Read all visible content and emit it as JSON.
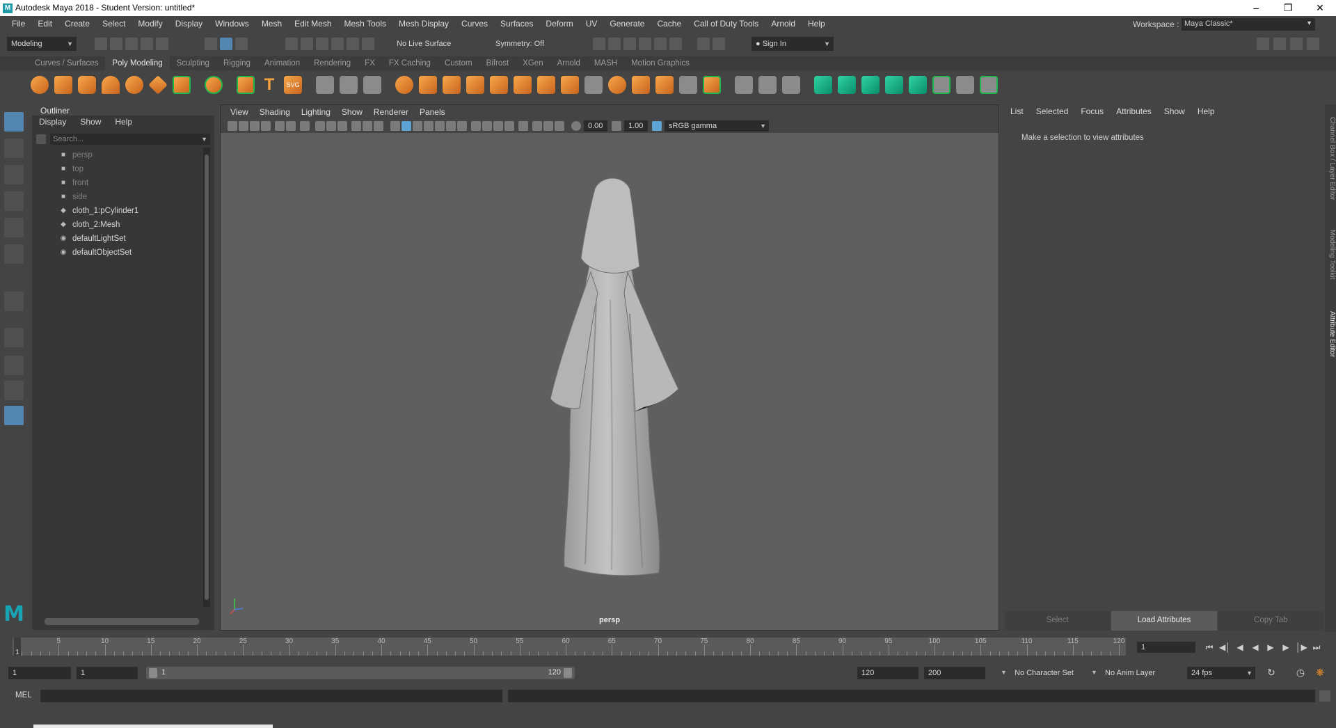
{
  "window": {
    "title": "Autodesk Maya 2018 - Student Version: untitled*",
    "app_icon": "M"
  },
  "menubar": [
    "File",
    "Edit",
    "Create",
    "Select",
    "Modify",
    "Display",
    "Windows",
    "Mesh",
    "Edit Mesh",
    "Mesh Tools",
    "Mesh Display",
    "Curves",
    "Surfaces",
    "Deform",
    "UV",
    "Generate",
    "Cache",
    "Call of Duty Tools",
    "Arnold",
    "Help"
  ],
  "workspace": {
    "label": "Workspace :",
    "value": "Maya Classic*"
  },
  "statusline": {
    "mode": "Modeling",
    "live_surface": "No Live Surface",
    "symmetry": "Symmetry: Off",
    "sign_in": "Sign In"
  },
  "shelf_tabs": {
    "items": [
      "Curves / Surfaces",
      "Poly Modeling",
      "Sculpting",
      "Rigging",
      "Animation",
      "Rendering",
      "FX",
      "FX Caching",
      "Custom",
      "Bifrost",
      "XGen",
      "Arnold",
      "MASH",
      "Motion Graphics"
    ],
    "active": "Poly Modeling"
  },
  "outliner": {
    "title": "Outliner",
    "menus": [
      "Display",
      "Show",
      "Help"
    ],
    "search_placeholder": "Search...",
    "items": [
      {
        "label": "persp",
        "icon": "camera-icon",
        "dim": true
      },
      {
        "label": "top",
        "icon": "camera-icon",
        "dim": true
      },
      {
        "label": "front",
        "icon": "camera-icon",
        "dim": true
      },
      {
        "label": "side",
        "icon": "camera-icon",
        "dim": true
      },
      {
        "label": "cloth_1:pCylinder1",
        "icon": "mesh-icon",
        "dim": false
      },
      {
        "label": "cloth_2:Mesh",
        "icon": "mesh-icon",
        "dim": false
      },
      {
        "label": "defaultLightSet",
        "icon": "set-icon",
        "dim": false
      },
      {
        "label": "defaultObjectSet",
        "icon": "set-icon",
        "dim": false
      }
    ]
  },
  "viewport": {
    "menus": [
      "View",
      "Shading",
      "Lighting",
      "Show",
      "Renderer",
      "Panels"
    ],
    "exposure": "0.00",
    "gamma": "1.00",
    "color_space": "sRGB gamma",
    "camera": "persp"
  },
  "attribute_editor": {
    "menus": [
      "List",
      "Selected",
      "Focus",
      "Attributes",
      "Show",
      "Help"
    ],
    "message": "Make a selection to view attributes",
    "buttons": [
      "Select",
      "Load Attributes",
      "Copy Tab"
    ]
  },
  "side_tabs": [
    "Channel Box / Layer Editor",
    "Modeling Toolkit",
    "Attribute Editor"
  ],
  "timeline": {
    "tick_labels": [
      "5",
      "10",
      "15",
      "20",
      "25",
      "30",
      "35",
      "40",
      "45",
      "50",
      "55",
      "60",
      "65",
      "70",
      "75",
      "80",
      "85",
      "90",
      "95",
      "100",
      "105",
      "110",
      "115",
      "120"
    ],
    "current_frame": "1",
    "marker_label": "1"
  },
  "range": {
    "start": "1",
    "playback_start": "1",
    "slider_start": "1",
    "slider_end": "120",
    "playback_end": "120",
    "end": "200",
    "character_set": "No Character Set",
    "anim_layer": "No Anim Layer",
    "fps": "24 fps"
  },
  "command_line": {
    "label": "MEL"
  },
  "colors": {
    "accent_orange": "#e8892b",
    "accent_teal": "#18b48a",
    "selection_blue": "#5386b0",
    "background": "#444444"
  }
}
